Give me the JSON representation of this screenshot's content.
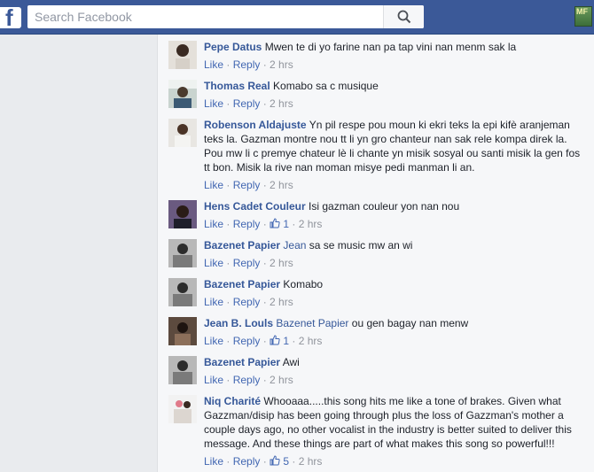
{
  "topbar": {
    "logo": "f",
    "search_placeholder": "Search Facebook",
    "corner_badge": "MF"
  },
  "icons": {
    "search": "search-icon",
    "like": "thumbs-up-icon",
    "brand": "facebook-logo-icon"
  },
  "colors": {
    "brand": "#3b5998",
    "link": "#365899",
    "meta": "#90949c"
  },
  "comments": [
    {
      "author": "Pepe Datus",
      "mention": "",
      "text": "Mwen te di yo farine nan pa tap vini nan menm sak la",
      "like": "Like",
      "reply": "Reply",
      "likes": "",
      "time": "2 hrs"
    },
    {
      "author": "Thomas Real",
      "mention": "",
      "text": "Komabo sa c musique",
      "like": "Like",
      "reply": "Reply",
      "likes": "",
      "time": "2 hrs"
    },
    {
      "author": "Robenson Aldajuste",
      "mention": "",
      "text": "Yn pil respe pou moun ki ekri teks la epi kifè aranjeman teks la. Gazman montre nou tt li yn gro chanteur nan sak rele kompa direk la. Pou mw li c premye chateur lè li chante yn misik sosyal ou santi misik la gen fos tt bon. Misik la rive nan moman misye pedi manman li an.",
      "like": "Like",
      "reply": "Reply",
      "likes": "",
      "time": "2 hrs"
    },
    {
      "author": "Hens Cadet Couleur",
      "mention": "",
      "text": "Isi gazman couleur yon nan nou",
      "like": "Like",
      "reply": "Reply",
      "likes": "1",
      "time": "2 hrs"
    },
    {
      "author": "Bazenet Papier",
      "mention": "Jean",
      "text": "sa se music mw an wi",
      "like": "Like",
      "reply": "Reply",
      "likes": "",
      "time": "2 hrs"
    },
    {
      "author": "Bazenet Papier",
      "mention": "",
      "text": "Komabo",
      "like": "Like",
      "reply": "Reply",
      "likes": "",
      "time": "2 hrs"
    },
    {
      "author": "Jean B. Louls",
      "mention": "Bazenet Papier",
      "text": "ou gen bagay nan menw",
      "like": "Like",
      "reply": "Reply",
      "likes": "1",
      "time": "2 hrs"
    },
    {
      "author": "Bazenet Papier",
      "mention": "",
      "text": "Awi",
      "like": "Like",
      "reply": "Reply",
      "likes": "",
      "time": "2 hrs"
    },
    {
      "author": "Niq Charité",
      "mention": "",
      "text": "Whooaaa.....this song hits me like a tone of brakes. Given what Gazzman/disip has been going through plus the loss of Gazzman's mother a couple days ago, no other vocalist in the industry is better suited to deliver this message. And these things are part of what makes this song so powerful!!!",
      "like": "Like",
      "reply": "Reply",
      "likes": "5",
      "time": "2 hrs"
    }
  ]
}
